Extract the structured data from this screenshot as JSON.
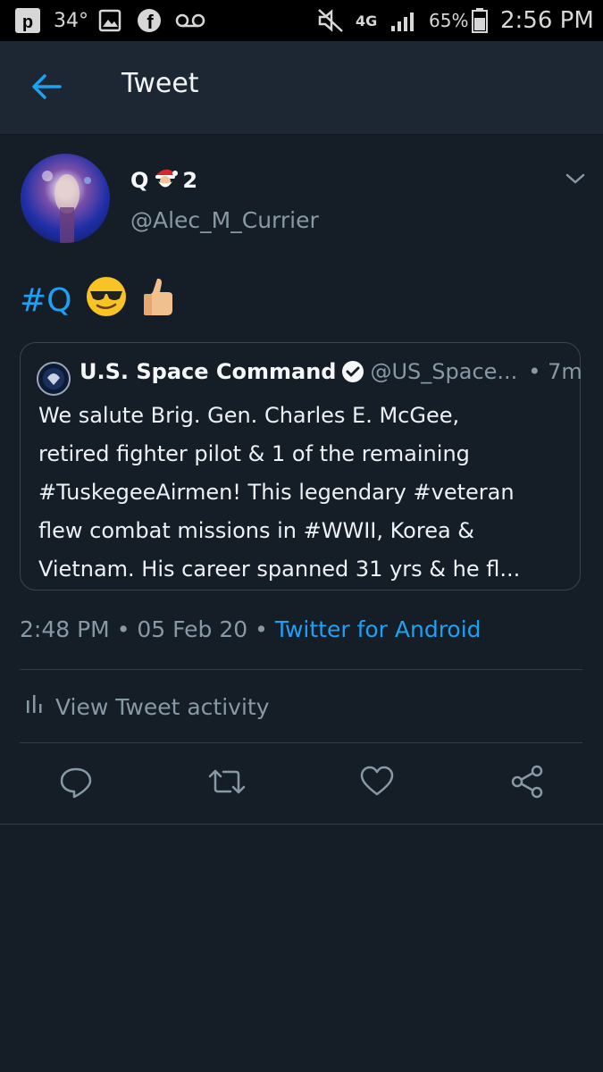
{
  "status_bar": {
    "temperature": "34°",
    "network": "4G",
    "battery": "65%",
    "time": "2:56 PM"
  },
  "app_bar": {
    "title": "Tweet"
  },
  "tweet": {
    "display_name_start": "Q",
    "display_name_end": "2",
    "handle": "@Alec_M_Currier",
    "hashtag": "#Q",
    "emojis": [
      "😎",
      "👍"
    ]
  },
  "quoted_tweet": {
    "name": "U.S. Space Command",
    "handle": "@US_Space...",
    "time": "• 7m",
    "text_lines": [
      "We salute Brig. Gen. Charles E. McGee,",
      "retired fighter pilot & 1 of the remaining",
      "#TuskegeeAirmen! This legendary #veteran",
      "flew combat missions in #WWII, Korea &",
      "Vietnam. His career spanned 31 yrs & he fl..."
    ]
  },
  "meta": {
    "time": "2:48 PM",
    "sep1": "•",
    "date": "05 Feb 20",
    "sep2": "•",
    "source": "Twitter for Android"
  },
  "activity": {
    "label": "View Tweet activity"
  },
  "colors": {
    "background": "#151d27",
    "link": "#1da1f2",
    "secondary_text": "#8899a6"
  }
}
